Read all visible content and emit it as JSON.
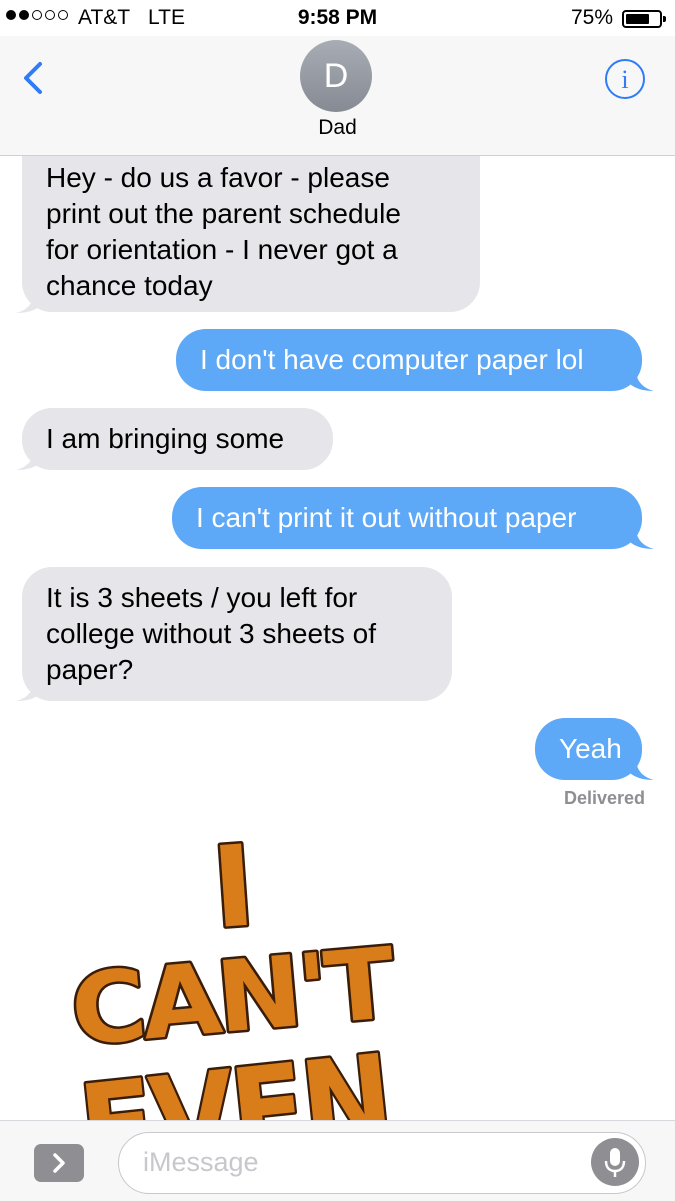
{
  "status_bar": {
    "signal_strength": "2 of 5 dots",
    "carrier": "AT&T",
    "network": "LTE",
    "time": "9:58 PM",
    "battery_percent": "75%",
    "battery_level": 0.75
  },
  "header": {
    "back_icon": "chevron-left-icon",
    "avatar_initial": "D",
    "contact_name": "Dad",
    "info_icon": "info-icon",
    "accent_color": "#2f7cf6"
  },
  "messages": [
    {
      "sender": "incoming",
      "lines": [
        "Hey - do us a favor - please",
        "print out the parent schedule",
        "for orientation - I never got a",
        "chance today"
      ]
    },
    {
      "sender": "outgoing",
      "lines": [
        "I don't have computer paper lol"
      ]
    },
    {
      "sender": "incoming",
      "lines": [
        "I am bringing some"
      ]
    },
    {
      "sender": "outgoing",
      "lines": [
        "I can't print it out without paper"
      ]
    },
    {
      "sender": "incoming",
      "lines": [
        "It is 3 sheets / you left for",
        "college without 3 sheets of",
        "paper?"
      ]
    },
    {
      "sender": "outgoing",
      "lines": [
        "Yeah"
      ]
    }
  ],
  "delivered_label": "Delivered",
  "sticker": {
    "lines": [
      "I",
      "CAN'T",
      "EVEN"
    ],
    "fill_color": "#d97d1b",
    "outline_color": "#3a1d08"
  },
  "input_bar": {
    "apps_icon": "chevron-right-icon",
    "placeholder": "iMessage",
    "mic_icon": "microphone-icon"
  },
  "colors": {
    "incoming_bubble": "#e5e5ea",
    "outgoing_bubble": "#5da8f7"
  }
}
